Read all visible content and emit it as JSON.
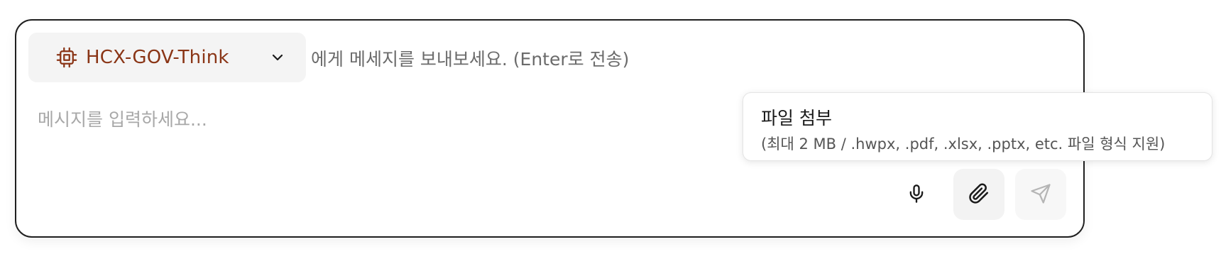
{
  "composer": {
    "model_selector": {
      "name": "HCX-GOV-Think",
      "icon": "cpu-chip-icon",
      "dropdown_icon": "chevron-down-icon",
      "accent_color": "#8a3516"
    },
    "hint": "에게 메세지를 보내보세요. (Enter로 전송)",
    "input": {
      "value": "",
      "placeholder": "메시지를 입력하세요..."
    },
    "actions": [
      {
        "name": "voice-input",
        "icon": "microphone-icon"
      },
      {
        "name": "attach-file",
        "icon": "paperclip-icon"
      },
      {
        "name": "send",
        "icon": "send-icon",
        "disabled": true
      }
    ]
  },
  "tooltip": {
    "title": "파일 첨부",
    "description": "(최대 2 MB / .hwpx, .pdf, .xlsx, .pptx, etc. 파일 형식 지원)"
  }
}
